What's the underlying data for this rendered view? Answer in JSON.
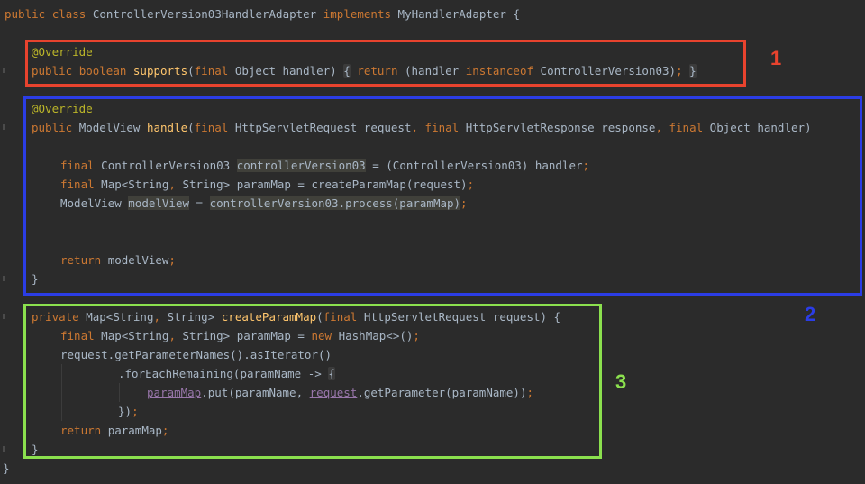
{
  "code": {
    "class_decl": {
      "kw_public": "public",
      "kw_class": "class",
      "name": "ControllerVersion03HandlerAdapter",
      "kw_implements": "implements",
      "iface": "MyHandlerAdapter",
      "brace": "{"
    },
    "supports": {
      "annotation": "@Override",
      "kw_public": "public",
      "kw_boolean": "boolean",
      "name": "supports",
      "params_open": "(",
      "kw_final": "final",
      "param": "Object handler)",
      "brace_open": "{",
      "kw_return": "return",
      "expr_a": "(handler",
      "kw_instanceof": "instanceof",
      "expr_b": "ControllerVersion03)",
      "semi": ";",
      "brace_close": "}"
    },
    "handle": {
      "annotation": "@Override",
      "kw_public": "public",
      "ret_type": "ModelView",
      "name": "handle",
      "p_open": "(",
      "kw_final1": "final",
      "p1": "HttpServletRequest request",
      "comma1": ",",
      "kw_final2": "final",
      "p2": "HttpServletResponse response",
      "comma2": ",",
      "kw_final3": "final",
      "p3": "Object handler)",
      "l1_final": "final",
      "l1_type": "ControllerVersion03",
      "l1_var": "controllerVersion03",
      "l1_rest": "= (ControllerVersion03) handler",
      "l1_semi": ";",
      "l2_final": "final",
      "l2_type": "Map<String",
      "l2_comma": ",",
      "l2_rest": "String> paramMap = createParamMap(request)",
      "l2_semi": ";",
      "l3_type": "ModelView",
      "l3_var": "modelView",
      "l3_eq": "=",
      "l3_call": "controllerVersion03.process(paramMap)",
      "l3_semi": ";",
      "ret_kw": "return",
      "ret_val": "modelView",
      "ret_semi": ";",
      "close": "}"
    },
    "create": {
      "kw_private": "private",
      "type_a": "Map<String",
      "comma": ",",
      "type_b": "String>",
      "name": "createParamMap",
      "p_open": "(",
      "kw_final": "final",
      "param": "HttpServletRequest request) {",
      "l1_final": "final",
      "l1_type": "Map<String",
      "l1_comma": ",",
      "l1_mid": "String> paramMap =",
      "l1_new": "new",
      "l1_rest": "HashMap<>()",
      "l1_semi": ";",
      "l2": "request.getParameterNames().asIterator()",
      "l3_call": ".forEachRemaining(paramName ->",
      "l3_brace": "{",
      "l4_field": "paramMap",
      "l4_mid": ".put(paramName,",
      "l4_req": "request",
      "l4_rest": ".getParameter(paramName))",
      "l4_semi": ";",
      "l5": "})",
      "l5_semi": ";",
      "ret_kw": "return",
      "ret_val": "paramMap",
      "ret_semi": ";",
      "close": "}"
    },
    "class_close": "}"
  },
  "annotations": {
    "label1": "1",
    "label2": "2",
    "label3": "3",
    "color1": "#e8432e",
    "color2": "#2b3de6",
    "color3": "#8be04e"
  }
}
